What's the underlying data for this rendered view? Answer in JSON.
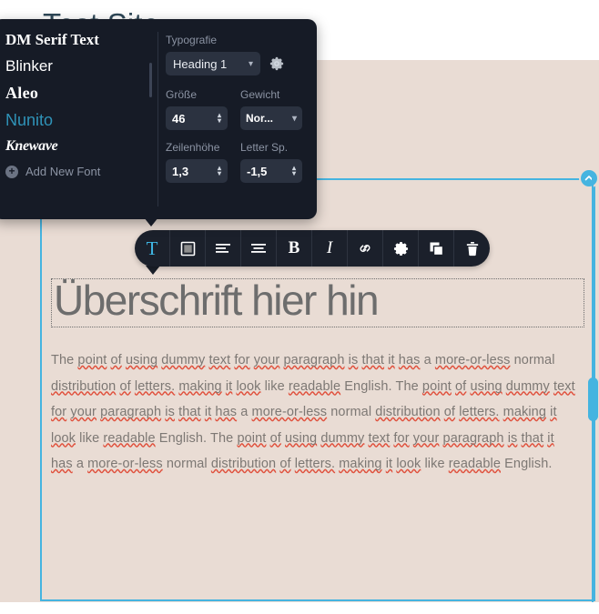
{
  "site": {
    "title": "Test Site"
  },
  "canvas": {
    "heading": "Überschrift hier hin",
    "paragraph_runs": [
      {
        "t": "The ",
        "sp": false
      },
      {
        "t": "point",
        "sp": true
      },
      {
        "t": " ",
        "sp": false
      },
      {
        "t": "of",
        "sp": true
      },
      {
        "t": " ",
        "sp": false
      },
      {
        "t": "using",
        "sp": true
      },
      {
        "t": " ",
        "sp": false
      },
      {
        "t": "dummy",
        "sp": true
      },
      {
        "t": " ",
        "sp": false
      },
      {
        "t": "text",
        "sp": true
      },
      {
        "t": " ",
        "sp": false
      },
      {
        "t": "for",
        "sp": true
      },
      {
        "t": " ",
        "sp": false
      },
      {
        "t": "your",
        "sp": true
      },
      {
        "t": " ",
        "sp": false
      },
      {
        "t": "paragraph",
        "sp": true
      },
      {
        "t": " ",
        "sp": false
      },
      {
        "t": "is",
        "sp": true
      },
      {
        "t": " ",
        "sp": false
      },
      {
        "t": "that",
        "sp": true
      },
      {
        "t": " ",
        "sp": false
      },
      {
        "t": "it",
        "sp": true
      },
      {
        "t": " ",
        "sp": false
      },
      {
        "t": "has",
        "sp": true
      },
      {
        "t": " a ",
        "sp": false
      },
      {
        "t": "more-or-less",
        "sp": true
      },
      {
        "t": " normal ",
        "sp": false
      },
      {
        "t": "distribution",
        "sp": true
      },
      {
        "t": " ",
        "sp": false
      },
      {
        "t": "of",
        "sp": true
      },
      {
        "t": " ",
        "sp": false
      },
      {
        "t": "letters.",
        "sp": true
      },
      {
        "t": " ",
        "sp": false
      },
      {
        "t": "making",
        "sp": true
      },
      {
        "t": " ",
        "sp": false
      },
      {
        "t": "it",
        "sp": true
      },
      {
        "t": " ",
        "sp": false
      },
      {
        "t": "look",
        "sp": true
      },
      {
        "t": " like ",
        "sp": false
      },
      {
        "t": "readable",
        "sp": true
      },
      {
        "t": " English. The ",
        "sp": false
      },
      {
        "t": "point",
        "sp": true
      },
      {
        "t": " ",
        "sp": false
      },
      {
        "t": "of",
        "sp": true
      },
      {
        "t": " ",
        "sp": false
      },
      {
        "t": "using",
        "sp": true
      },
      {
        "t": " ",
        "sp": false
      },
      {
        "t": "dummy",
        "sp": true
      },
      {
        "t": " ",
        "sp": false
      },
      {
        "t": "text",
        "sp": true
      },
      {
        "t": " ",
        "sp": false
      },
      {
        "t": "for",
        "sp": true
      },
      {
        "t": " ",
        "sp": false
      },
      {
        "t": "your",
        "sp": true
      },
      {
        "t": " ",
        "sp": false
      },
      {
        "t": "paragraph",
        "sp": true
      },
      {
        "t": " ",
        "sp": false
      },
      {
        "t": "is",
        "sp": true
      },
      {
        "t": " ",
        "sp": false
      },
      {
        "t": "that",
        "sp": true
      },
      {
        "t": " ",
        "sp": false
      },
      {
        "t": "it",
        "sp": true
      },
      {
        "t": " ",
        "sp": false
      },
      {
        "t": "has",
        "sp": true
      },
      {
        "t": " a ",
        "sp": false
      },
      {
        "t": "more-or-less",
        "sp": true
      },
      {
        "t": " normal ",
        "sp": false
      },
      {
        "t": "distribution",
        "sp": true
      },
      {
        "t": " ",
        "sp": false
      },
      {
        "t": "of",
        "sp": true
      },
      {
        "t": " ",
        "sp": false
      },
      {
        "t": "letters.",
        "sp": true
      },
      {
        "t": " ",
        "sp": false
      },
      {
        "t": "making",
        "sp": true
      },
      {
        "t": " ",
        "sp": false
      },
      {
        "t": "it",
        "sp": true
      },
      {
        "t": " ",
        "sp": false
      },
      {
        "t": "look",
        "sp": true
      },
      {
        "t": " like ",
        "sp": false
      },
      {
        "t": "readable",
        "sp": true
      },
      {
        "t": " English. The ",
        "sp": false
      },
      {
        "t": "point",
        "sp": true
      },
      {
        "t": " ",
        "sp": false
      },
      {
        "t": "of",
        "sp": true
      },
      {
        "t": " ",
        "sp": false
      },
      {
        "t": "using",
        "sp": true
      },
      {
        "t": " ",
        "sp": false
      },
      {
        "t": "dummy",
        "sp": true
      },
      {
        "t": " ",
        "sp": false
      },
      {
        "t": "text",
        "sp": true
      },
      {
        "t": " ",
        "sp": false
      },
      {
        "t": "for",
        "sp": true
      },
      {
        "t": " ",
        "sp": false
      },
      {
        "t": "your",
        "sp": true
      },
      {
        "t": " ",
        "sp": false
      },
      {
        "t": "paragraph",
        "sp": true
      },
      {
        "t": " ",
        "sp": false
      },
      {
        "t": "is",
        "sp": true
      },
      {
        "t": " ",
        "sp": false
      },
      {
        "t": "that",
        "sp": true
      },
      {
        "t": " ",
        "sp": false
      },
      {
        "t": "it",
        "sp": true
      },
      {
        "t": " ",
        "sp": false
      },
      {
        "t": "has",
        "sp": true
      },
      {
        "t": " a ",
        "sp": false
      },
      {
        "t": "more-or-less",
        "sp": true
      },
      {
        "t": " normal ",
        "sp": false
      },
      {
        "t": "distribution",
        "sp": true
      },
      {
        "t": " ",
        "sp": false
      },
      {
        "t": "of",
        "sp": true
      },
      {
        "t": " ",
        "sp": false
      },
      {
        "t": "letters.",
        "sp": true
      },
      {
        "t": " ",
        "sp": false
      },
      {
        "t": "making",
        "sp": true
      },
      {
        "t": " ",
        "sp": false
      },
      {
        "t": "it",
        "sp": true
      },
      {
        "t": " ",
        "sp": false
      },
      {
        "t": "look",
        "sp": true
      },
      {
        "t": " like ",
        "sp": false
      },
      {
        "t": "readable",
        "sp": true
      },
      {
        "t": " English.",
        "sp": false
      }
    ]
  },
  "toolbar": {
    "buttons": [
      {
        "name": "text-tool",
        "icon": "T-icon",
        "glyph": "T",
        "active": true
      },
      {
        "name": "color-tool",
        "icon": "color-square-icon",
        "glyph": "",
        "active": false
      },
      {
        "name": "align-left",
        "icon": "align-left-icon",
        "glyph": "",
        "active": false
      },
      {
        "name": "align-center",
        "icon": "align-center-icon",
        "glyph": "",
        "active": false
      },
      {
        "name": "bold",
        "icon": "bold-icon",
        "glyph": "B",
        "active": false
      },
      {
        "name": "italic",
        "icon": "italic-icon",
        "glyph": "I",
        "active": false
      },
      {
        "name": "link",
        "icon": "link-icon",
        "glyph": "",
        "active": false
      },
      {
        "name": "settings",
        "icon": "gear-icon",
        "glyph": "",
        "active": false
      },
      {
        "name": "duplicate",
        "icon": "duplicate-icon",
        "glyph": "",
        "active": false
      },
      {
        "name": "delete",
        "icon": "trash-icon",
        "glyph": "",
        "active": false
      }
    ]
  },
  "panel": {
    "fonts": [
      {
        "label": "DM Serif Text",
        "selected": false
      },
      {
        "label": "Blinker",
        "selected": false
      },
      {
        "label": "Aleo",
        "selected": false
      },
      {
        "label": "Nunito",
        "selected": true
      },
      {
        "label": "Knewave",
        "selected": false
      }
    ],
    "add_new_font": "Add New Font",
    "typography_label": "Typografie",
    "typography_value": "Heading 1",
    "size_label": "Größe",
    "size_value": "46",
    "weight_label": "Gewicht",
    "weight_value": "Nor...",
    "lineheight_label": "Zeilenhöhe",
    "lineheight_value": "1,3",
    "letterspacing_label": "Letter Sp.",
    "letterspacing_value": "-1,5"
  },
  "colors": {
    "accent": "#45b4e0",
    "panel_bg": "#161b26",
    "toolbar_bg": "#1b202b",
    "canvas_bg": "#e9dcd4",
    "selected_font": "#2f93b8",
    "heading_text": "#6d6d6d",
    "body_text": "#7d7874",
    "spellcheck": "#e0503c",
    "site_title": "#2f4858"
  }
}
